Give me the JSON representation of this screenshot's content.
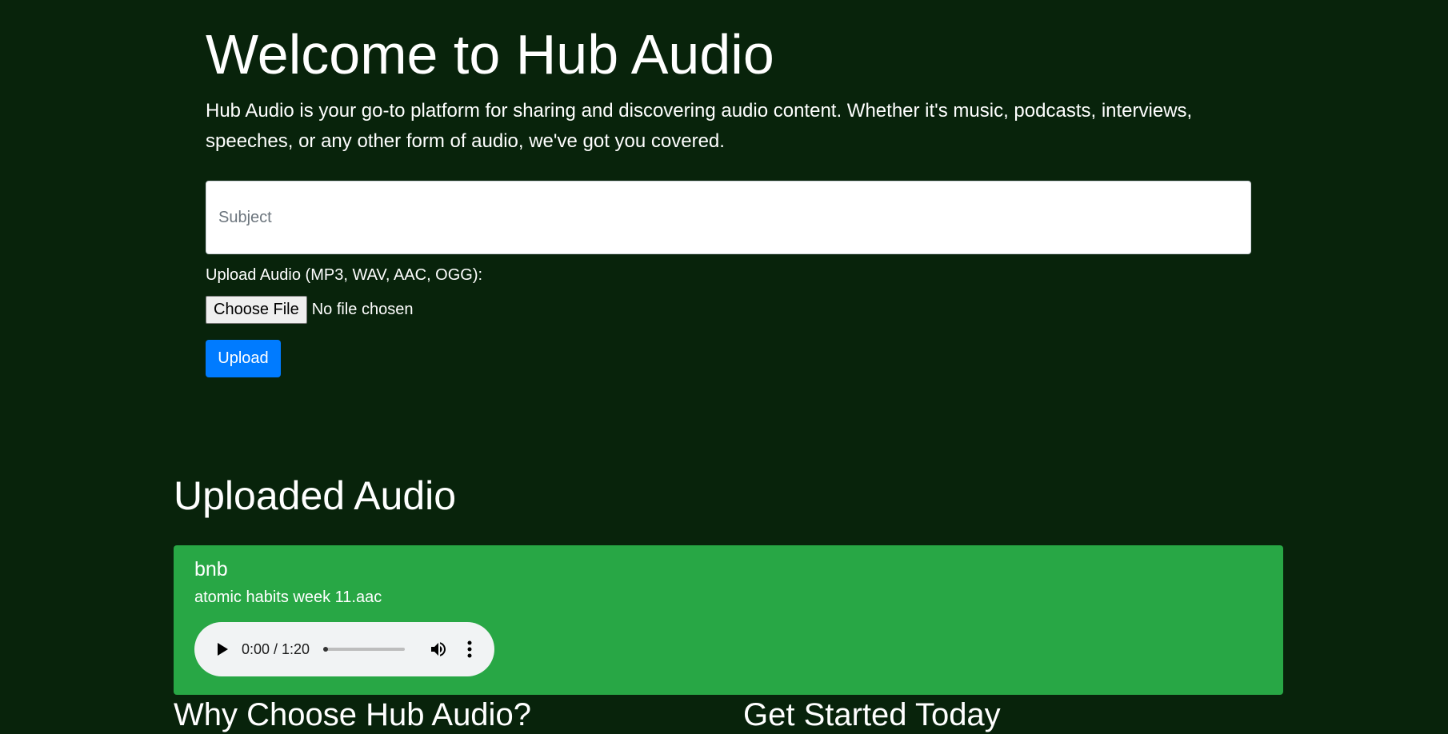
{
  "hero": {
    "title": "Welcome to Hub Audio",
    "description": "Hub Audio is your go-to platform for sharing and discovering audio content. Whether it's music, podcasts, interviews, speeches, or any other form of audio, we've got you covered."
  },
  "form": {
    "subject_placeholder": "Subject",
    "subject_value": "",
    "upload_label": "Upload Audio (MP3, WAV, AAC, OGG):",
    "choose_file_label": "Choose File",
    "no_file_text": "No file chosen",
    "upload_button": "Upload"
  },
  "uploaded": {
    "title": "Uploaded Audio",
    "items": [
      {
        "subject": "bnb",
        "filename": "atomic habits week 11.aac",
        "player": {
          "time": "0:00 / 1:20",
          "progress": 0,
          "play_icon": "play-icon",
          "volume_icon": "volume-icon",
          "more_icon": "more-vertical-icon"
        }
      }
    ]
  },
  "sections": {
    "why_title": "Why Choose Hub Audio?",
    "started_title": "Get Started Today"
  },
  "colors": {
    "background": "#08230b",
    "card": "#28a745",
    "primary_button": "#007bff"
  }
}
